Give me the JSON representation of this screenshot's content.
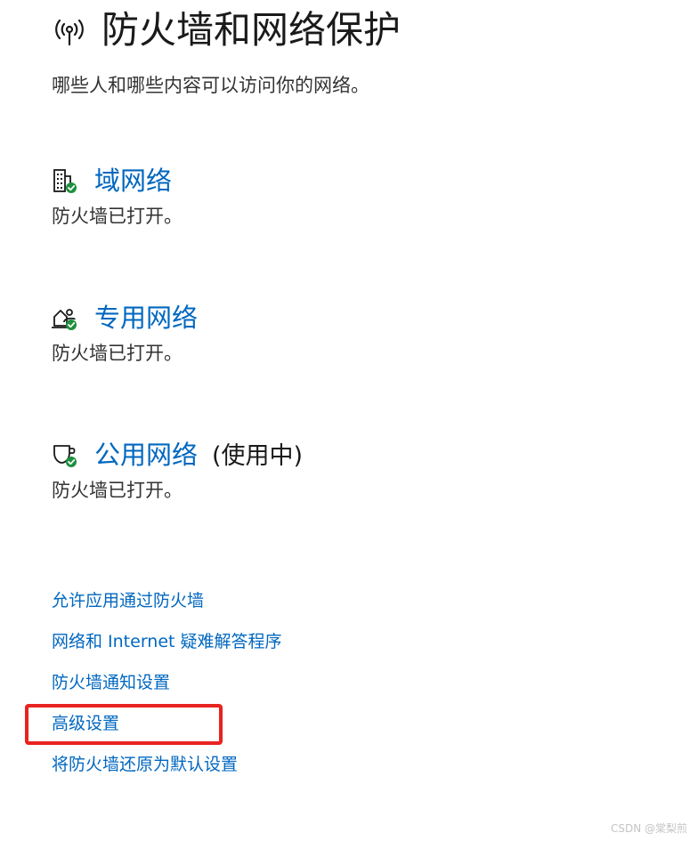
{
  "page": {
    "title": "防火墙和网络保护",
    "subtitle": "哪些人和哪些内容可以访问你的网络。",
    "icon": "wireless-antenna-icon"
  },
  "networks": [
    {
      "name": "域网络",
      "status": "防火墙已打开。",
      "icon": "domain-network-icon",
      "active_label": ""
    },
    {
      "name": "专用网络",
      "status": "防火墙已打开。",
      "icon": "private-network-icon",
      "active_label": ""
    },
    {
      "name": "公用网络",
      "status": "防火墙已打开。",
      "icon": "public-network-icon",
      "active_label": "(使用中)"
    }
  ],
  "links": [
    "允许应用通过防火墙",
    "网络和 Internet 疑难解答程序",
    "防火墙通知设置",
    "高级设置",
    "将防火墙还原为默认设置"
  ],
  "highlighted_link": "高级设置",
  "watermark": "CSDN @棠梨煎",
  "colors": {
    "link": "#0067c0",
    "check_badge": "#1e8f3e",
    "highlight": "#e8231f",
    "text": "#1a1a1a"
  }
}
